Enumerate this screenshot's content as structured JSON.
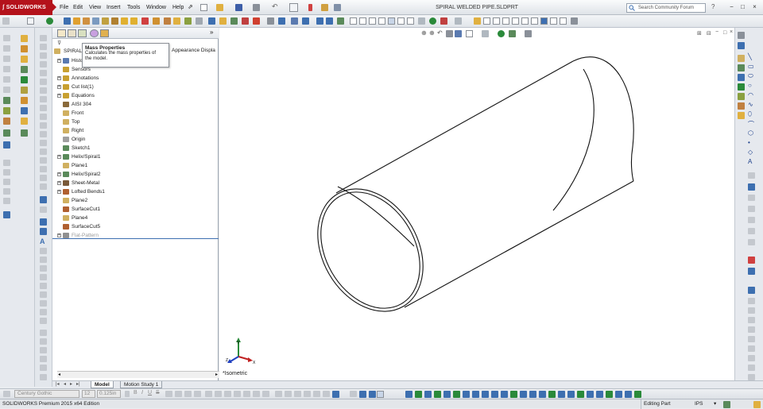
{
  "app": {
    "brand": "SOLIDWORKS",
    "document_title": "SPIRAL WELDED PIPE.SLDPRT",
    "window_controls": [
      "−",
      "□",
      "×"
    ]
  },
  "menu": [
    "File",
    "Edit",
    "View",
    "Insert",
    "Tools",
    "Window",
    "Help"
  ],
  "search": {
    "placeholder": "Search Community Forum"
  },
  "panel": {
    "collapse_label": "»",
    "tabs": [
      "feature-manager",
      "property-manager",
      "configuration-manager",
      "dim-expert",
      "display-manager"
    ],
    "root_label": "SPIRAL",
    "appearance_label": "Appearance Displa",
    "tree": [
      {
        "label": "Histo",
        "icon": "history-icon",
        "expand": "+",
        "color": "#5a7ab0"
      },
      {
        "label": "Sensors",
        "icon": "sensor-icon",
        "expand": "",
        "color": "#c8a030"
      },
      {
        "label": "Annotations",
        "icon": "annotation-icon",
        "expand": "+",
        "color": "#c8a030"
      },
      {
        "label": "Cut list(1)",
        "icon": "cut-list-icon",
        "expand": "+",
        "color": "#c8a030"
      },
      {
        "label": "Equations",
        "icon": "equations-icon",
        "expand": "+",
        "color": "#c8a030"
      },
      {
        "label": "AISI 304",
        "icon": "material-icon",
        "expand": "",
        "color": "#8a6a3a"
      },
      {
        "label": "Front",
        "icon": "plane-icon",
        "expand": "",
        "color": "#d0b060"
      },
      {
        "label": "Top",
        "icon": "plane-icon",
        "expand": "",
        "color": "#d0b060"
      },
      {
        "label": "Right",
        "icon": "plane-icon",
        "expand": "",
        "color": "#d0b060"
      },
      {
        "label": "Origin",
        "icon": "origin-icon",
        "expand": "",
        "color": "#a0a0a0"
      },
      {
        "label": "Sketch1",
        "icon": "sketch-icon",
        "expand": "",
        "color": "#5a8a5a"
      },
      {
        "label": "Helix/Spiral1",
        "icon": "helix-icon",
        "expand": "+",
        "color": "#5a8a5a"
      },
      {
        "label": "Plane1",
        "icon": "plane-icon",
        "expand": "",
        "color": "#d0b060"
      },
      {
        "label": "Helix/Spiral2",
        "icon": "helix-icon",
        "expand": "+",
        "color": "#5a8a5a"
      },
      {
        "label": "Sheet-Metal",
        "icon": "sheet-metal-icon",
        "expand": "+",
        "color": "#7a5a3a"
      },
      {
        "label": "Lofted Bends1",
        "icon": "lofted-bend-icon",
        "expand": "+",
        "color": "#b06030"
      },
      {
        "label": "Plane2",
        "icon": "plane-icon",
        "expand": "",
        "color": "#d0b060"
      },
      {
        "label": "SurfaceCut1",
        "icon": "surface-cut-icon",
        "expand": "",
        "color": "#b06030"
      },
      {
        "label": "Plane4",
        "icon": "plane-icon",
        "expand": "",
        "color": "#d0b060"
      },
      {
        "label": "SurfaceCut5",
        "icon": "surface-cut-icon",
        "expand": "",
        "color": "#b06030"
      },
      {
        "label": "Flat-Pattern",
        "icon": "flat-pattern-icon",
        "expand": "+",
        "color": "#909090",
        "muted": true
      }
    ]
  },
  "tooltip": {
    "title": "Mass Properties",
    "description_line1": "Calculates the mass properties of",
    "description_line2": "the model."
  },
  "bottom_tabs": [
    "Model",
    "Motion Study 1"
  ],
  "viewport": {
    "view_label": "*Isometric",
    "triad": {
      "x": "X",
      "y": "Y",
      "z": "Z"
    }
  },
  "format_bar": {
    "font": "Century Gothic",
    "size": "12",
    "line_thickness": "0.125in"
  },
  "status": {
    "left": "SOLIDWORKS Premium 2015 x64 Edition",
    "mode": "Editing Part",
    "units": "IPS"
  },
  "colors": {
    "brand_red": "#b4121b",
    "selection_blue": "#3d6fb0"
  }
}
